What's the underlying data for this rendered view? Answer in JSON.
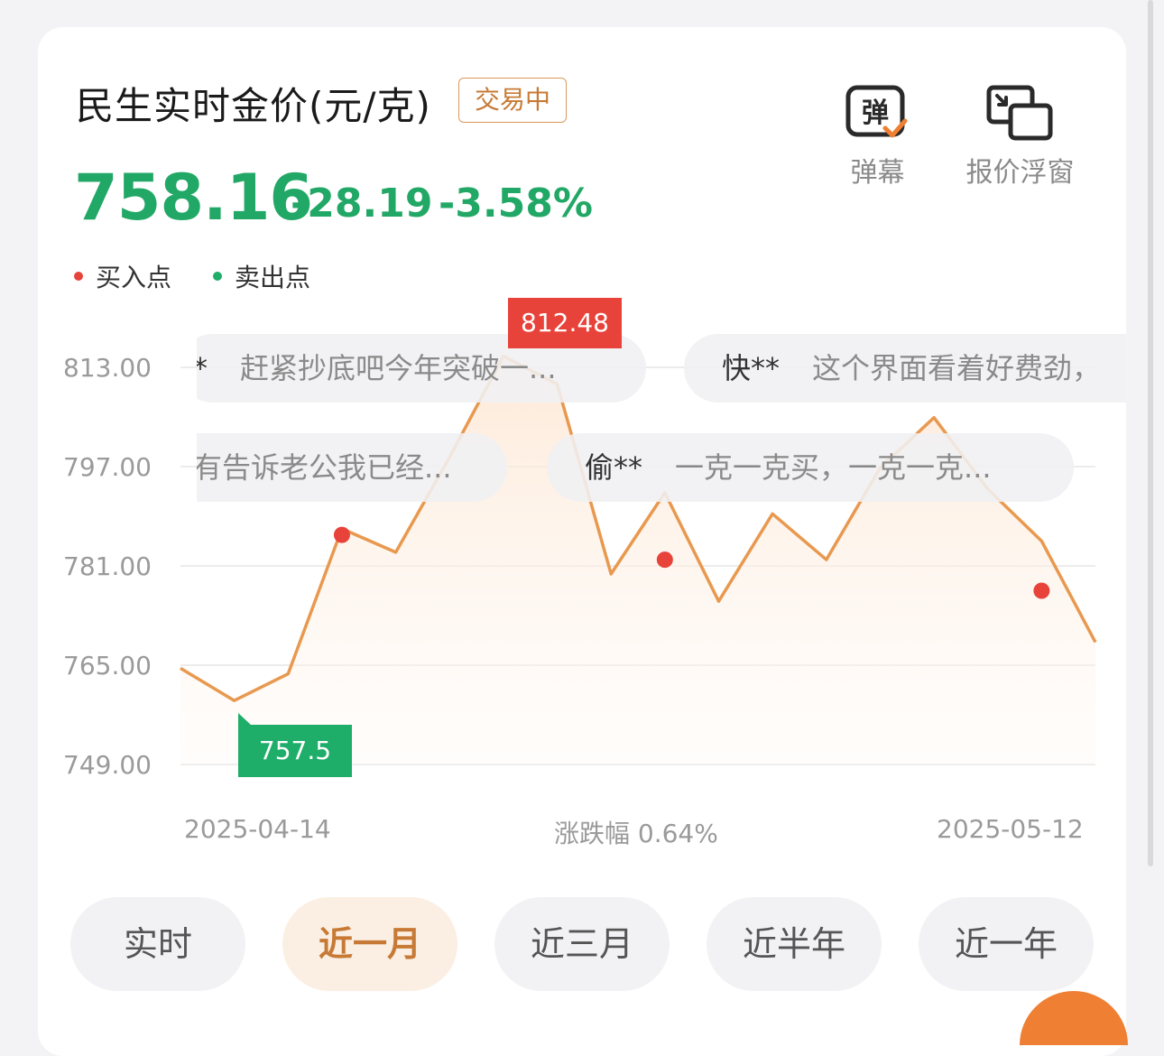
{
  "header": {
    "title": "民生实时金价(元/克)",
    "status_badge": "交易中",
    "price": "758.16",
    "change": "-28.19",
    "change_pct": "-3.58%"
  },
  "tools": {
    "danmu_label": "弹幕",
    "danmu_icon_text": "弹",
    "float_label": "报价浮窗"
  },
  "legend": {
    "buy": "买入点",
    "sell": "卖出点"
  },
  "colors": {
    "up_green": "#22a866",
    "line": "#e8994f",
    "buy_dot": "#e8433a",
    "sell_dot": "#1fae69",
    "accent": "#c77a35"
  },
  "chart_data": {
    "type": "area",
    "yticks": [
      "813.00",
      "797.00",
      "781.00",
      "765.00",
      "749.00"
    ],
    "ylim": [
      749,
      813
    ],
    "x_start_label": "2025-04-14",
    "x_end_label": "2025-05-12",
    "center_label": "涨跌幅 0.64%",
    "series": [
      {
        "values": [
          764.5,
          759.3,
          763.6,
          787.0,
          783.2,
          798.5,
          814.8,
          810.3,
          779.7,
          792.8,
          775.3,
          789.4,
          782.0,
          796.8,
          804.9,
          793.4,
          785.0,
          768.7
        ]
      }
    ],
    "buy_points": [
      {
        "index": 3,
        "value": 786.0
      },
      {
        "index": 9,
        "value": 782.0
      },
      {
        "index": 16,
        "value": 777.0
      }
    ],
    "high_label": "812.48",
    "low_label": "757.5"
  },
  "danmu": [
    {
      "user": "**",
      "text": "赶紧抄底吧今年突破一..."
    },
    {
      "user": "快**",
      "text": "这个界面看着好费劲，"
    },
    {
      "user": "",
      "text": "有告诉老公我已经..."
    },
    {
      "user": "偷**",
      "text": "一克一克买，一克一克..."
    }
  ],
  "tabs": [
    "实时",
    "近一月",
    "近三月",
    "近半年",
    "近一年"
  ],
  "active_tab": "近一月"
}
